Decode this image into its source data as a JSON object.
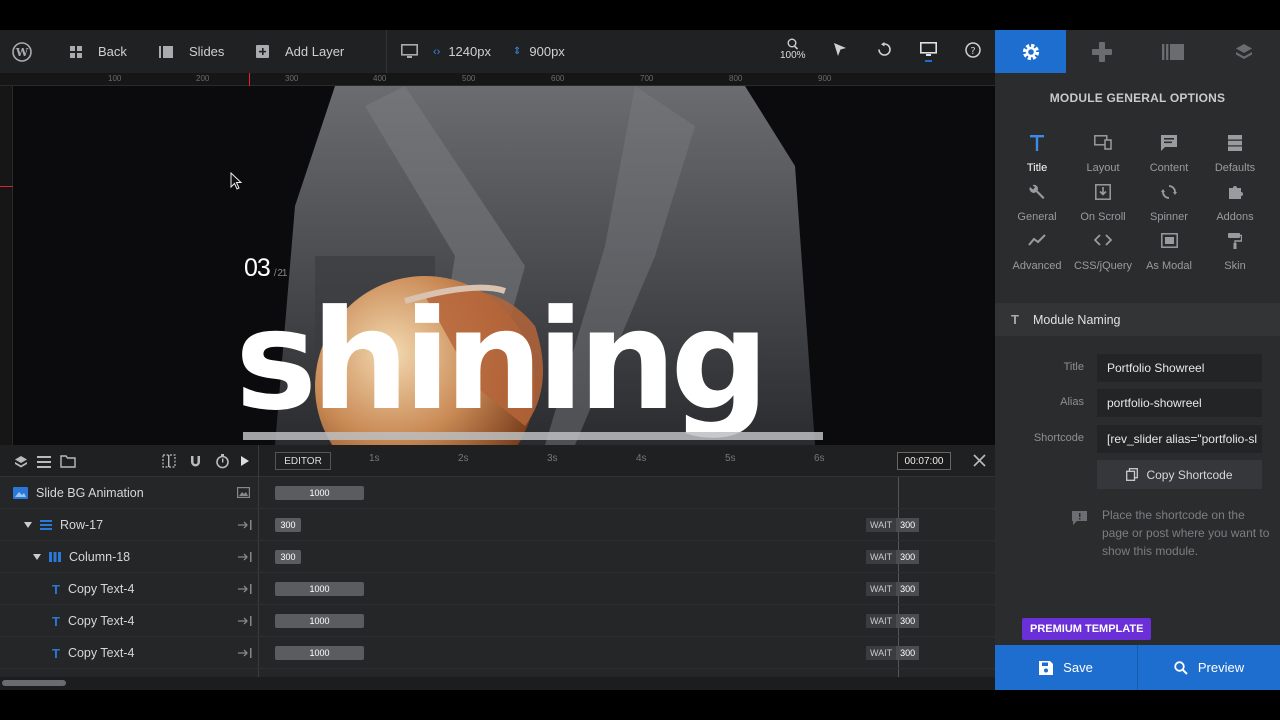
{
  "toolbar": {
    "back_label": "Back",
    "slides_label": "Slides",
    "add_layer_label": "Add Layer",
    "width_value": "1240px",
    "height_value": "900px",
    "zoom_value": "100%"
  },
  "ruler": {
    "ticks": [
      "100",
      "200",
      "300",
      "400",
      "500",
      "600",
      "700",
      "800",
      "900"
    ]
  },
  "canvas": {
    "slide_number": "03",
    "slide_total": "/ 21",
    "headline": "shining"
  },
  "timeline": {
    "editor_label": "EDITOR",
    "ticks": [
      "1s",
      "2s",
      "3s",
      "4s",
      "5s",
      "6s"
    ],
    "current_time": "00:07:00",
    "wait_label": "WAIT",
    "rows": [
      {
        "name": "Slide BG Animation",
        "bar": "1000",
        "wait": ""
      },
      {
        "name": "Row-17",
        "bar": "300",
        "wait": "300"
      },
      {
        "name": "Column-18",
        "bar": "300",
        "wait": "300"
      },
      {
        "name": "Copy Text-4",
        "bar": "1000",
        "wait": "300"
      },
      {
        "name": "Copy Text-4",
        "bar": "1000",
        "wait": "300"
      },
      {
        "name": "Copy Text-4",
        "bar": "1000",
        "wait": "300"
      }
    ]
  },
  "panel": {
    "title": "MODULE GENERAL OPTIONS",
    "options": [
      {
        "label": "Title",
        "icon": "title-icon"
      },
      {
        "label": "Layout",
        "icon": "layout-icon"
      },
      {
        "label": "Content",
        "icon": "content-icon"
      },
      {
        "label": "Defaults",
        "icon": "defaults-icon"
      },
      {
        "label": "General",
        "icon": "wrench-icon"
      },
      {
        "label": "On Scroll",
        "icon": "scroll-icon"
      },
      {
        "label": "Spinner",
        "icon": "spinner-icon"
      },
      {
        "label": "Addons",
        "icon": "puzzle-icon"
      },
      {
        "label": "Advanced",
        "icon": "chart-icon"
      },
      {
        "label": "CSS/jQuery",
        "icon": "code-icon"
      },
      {
        "label": "As Modal",
        "icon": "modal-icon"
      },
      {
        "label": "Skin",
        "icon": "paint-roller-icon"
      }
    ],
    "section_title": "Module Naming",
    "title_label": "Title",
    "title_value": "Portfolio Showreel",
    "alias_label": "Alias",
    "alias_value": "portfolio-showreel",
    "shortcode_label": "Shortcode",
    "shortcode_value": "[rev_slider alias=\"portfolio-sl",
    "copy_label": "Copy Shortcode",
    "hint": "Place the shortcode on the page or post where you want to show this module.",
    "premium_label": "PREMIUM TEMPLATE"
  },
  "footer": {
    "save_label": "Save",
    "preview_label": "Preview"
  },
  "colors": {
    "accent": "#1e6ecf",
    "premium": "#6a2fd6"
  }
}
